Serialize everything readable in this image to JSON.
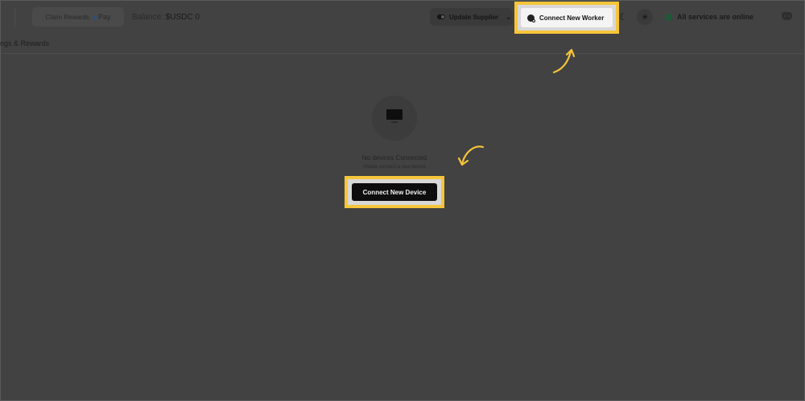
{
  "header": {
    "claim_label": "Claim Rewards",
    "pay_label": "Pay",
    "balance_label": "Balance:",
    "balance_value": "$USDC 0",
    "update_supplier_label": "Update Supplier",
    "connect_worker_label": "Connect New Worker",
    "status_text": "All services are online"
  },
  "subnav": {
    "label": "ings & Rewards"
  },
  "empty_state": {
    "title": "No devices Connected",
    "subtitle": "Please connect a new device",
    "button_label": "Connect New Device"
  },
  "colors": {
    "highlight": "#f6c53a",
    "overlay": "#424242",
    "status_online": "#1e5a38"
  },
  "icons": [
    "toggle-icon",
    "chevron-down-icon",
    "plug-icon",
    "moon-icon",
    "sun-icon",
    "discord-icon",
    "monitor-icon",
    "arrow-icon"
  ]
}
